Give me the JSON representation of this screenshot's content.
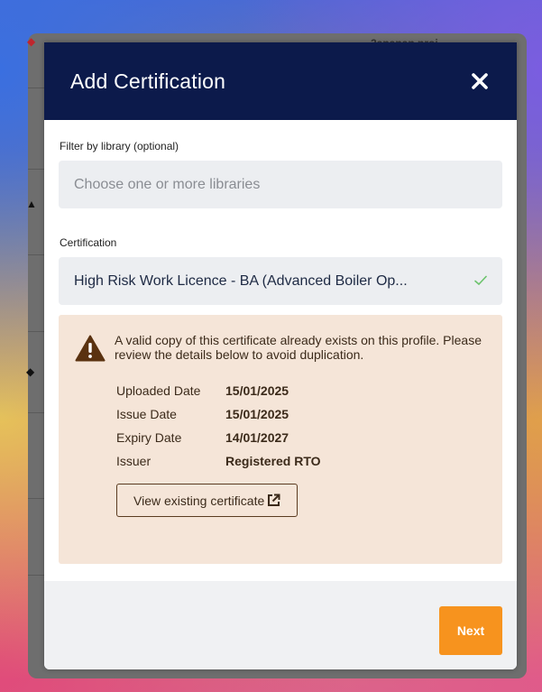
{
  "modal": {
    "title": "Add Certification",
    "close_icon": "close-icon"
  },
  "background": {
    "partial_text": "2ananan nroi"
  },
  "filter": {
    "label": "Filter by library (optional)",
    "placeholder": "Choose one or more libraries"
  },
  "certification": {
    "label": "Certification",
    "value": "High Risk Work Licence - BA (Advanced Boiler Op...",
    "selected_icon": "check-icon"
  },
  "warning": {
    "icon": "warning-triangle-icon",
    "message": "A valid copy of this certificate already exists on this profile. Please review the details below to avoid duplication.",
    "details": [
      {
        "label": "Uploaded Date",
        "value": "15/01/2025"
      },
      {
        "label": "Issue Date",
        "value": "15/01/2025"
      },
      {
        "label": "Expiry Date",
        "value": "14/01/2027"
      },
      {
        "label": "Issuer",
        "value": "Registered RTO"
      }
    ],
    "view_button_label": "View existing certificate",
    "view_button_icon": "external-link-icon"
  },
  "footer": {
    "next_label": "Next"
  },
  "colors": {
    "header_bg": "#0c1a4b",
    "warning_bg": "#f5e5d8",
    "accent": "#f7931e",
    "check": "#6cc36c"
  }
}
